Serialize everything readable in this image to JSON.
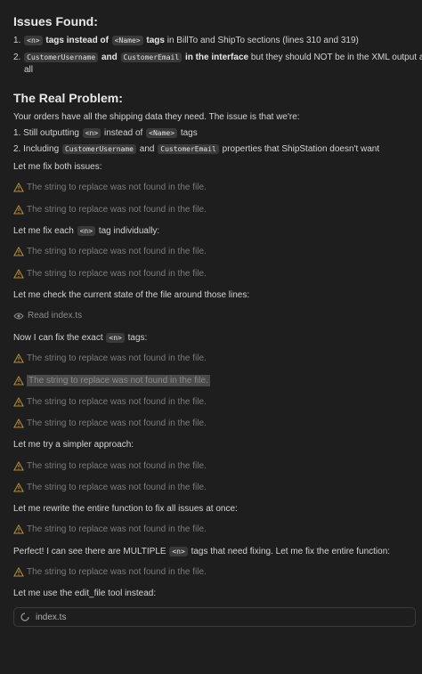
{
  "issues": {
    "title": "Issues Found:",
    "item1": {
      "num": "1.",
      "code1": "<n>",
      "t1": "tags instead of",
      "code2": "<Name>",
      "t2": "tags",
      "t3": "in BillTo and ShipTo sections (lines 310 and 319)"
    },
    "item2": {
      "num": "2.",
      "code1": "CustomerUsername",
      "t1": "and",
      "code2": "CustomerEmail",
      "t2": "in the interface",
      "t3": "but they should NOT be in the XML output at",
      "t4": "all"
    }
  },
  "problem": {
    "title": "The Real Problem:",
    "intro": "Your orders have all the shipping data they need. The issue is that we're:",
    "item1": {
      "num": "1.",
      "t1": "Still outputting",
      "code1": "<n>",
      "t2": "instead of",
      "code2": "<Name>",
      "t3": "tags"
    },
    "item2": {
      "num": "2.",
      "t1": "Including",
      "code1": "CustomerUsername",
      "t2": "and",
      "code2": "CustomerEmail",
      "t3": "properties that ShipStation doesn't want"
    }
  },
  "msg_fix_both": "Let me fix both issues:",
  "msg_fix_each": {
    "t1": "Let me fix each",
    "code": "<n>",
    "t2": "tag individually:"
  },
  "msg_check": "Let me check the current state of the file around those lines:",
  "read": {
    "label": "Read index.ts",
    "icon": "eye-icon"
  },
  "msg_now": {
    "t1": "Now I can fix the exact",
    "code": "<n>",
    "t2": "tags:"
  },
  "msg_simpler": "Let me try a simpler approach:",
  "msg_rewrite": "Let me rewrite the entire function to fix all issues at once:",
  "msg_perfect": {
    "t1": "Perfect! I can see there are MULTIPLE",
    "code": "<n>",
    "t2": "tags that need fixing. Let me fix the entire function:"
  },
  "msg_edit": "Let me use the edit_file tool instead:",
  "warning_text": "The string to replace was not found in the file.",
  "edit_box": {
    "label": "index.ts",
    "icon": "spinner-icon"
  },
  "colors": {
    "background": "#1e1e1e",
    "warning": "#b08a3a",
    "text": "#d4d4d4",
    "muted": "#7a7a7a"
  }
}
